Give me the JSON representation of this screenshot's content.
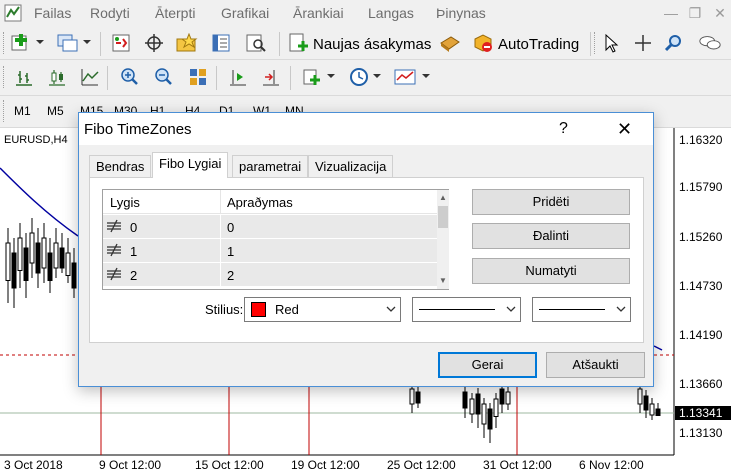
{
  "menu": {
    "items": [
      "Failas",
      "Rodyti",
      "Āterpti",
      "Grafikai",
      "Ārankiai",
      "Langas",
      "Þinynas"
    ],
    "minimize": "—",
    "restore": "❐",
    "close": "✕"
  },
  "toolbar": {
    "new_order": "Naujas ásakymas",
    "autotrading": "AutoTrading"
  },
  "timeframes": [
    "M1",
    "M5",
    "M15",
    "M30",
    "H1",
    "H4",
    "D1",
    "W1",
    "MN"
  ],
  "chart": {
    "symbol": "EURUSD,H4",
    "prices": [
      "1.16320",
      "1.15790",
      "1.15260",
      "1.14730",
      "1.14190",
      "1.13660",
      "1.13130"
    ],
    "current_price": "1.13341",
    "dates": [
      "3 Oct 2018",
      "9 Oct 12:00",
      "15 Oct 12:00",
      "19 Oct 12:00",
      "25 Oct 12:00",
      "31 Oct 12:00",
      "6 Nov 12:00"
    ],
    "colors": {
      "candle": "#000000",
      "moving_average": "#0000a0",
      "fibo_line": "#c00000",
      "level_line": "#c00000"
    }
  },
  "dialog": {
    "title": "Fibo TimeZones",
    "help": "?",
    "close": "✕",
    "tabs": [
      "Bendras",
      "Fibo Lygiai",
      "parametrai",
      "Vizualizacija"
    ],
    "active_tab": "Fibo Lygiai",
    "grid": {
      "headers": [
        "Lygis",
        "Aprašymas"
      ],
      "header_desc": "Apraðymas",
      "rows": [
        {
          "level": "0",
          "description": "0"
        },
        {
          "level": "1",
          "description": "1"
        },
        {
          "level": "2",
          "description": "2"
        }
      ]
    },
    "buttons": {
      "add": "Pridëti",
      "delete": "Ðalinti",
      "defaults": "Numatyti"
    },
    "style": {
      "label": "Stilius:",
      "color_name": "Red",
      "color": "#ff0000"
    },
    "footer": {
      "ok": "Gerai",
      "cancel": "Atšaukti"
    }
  }
}
